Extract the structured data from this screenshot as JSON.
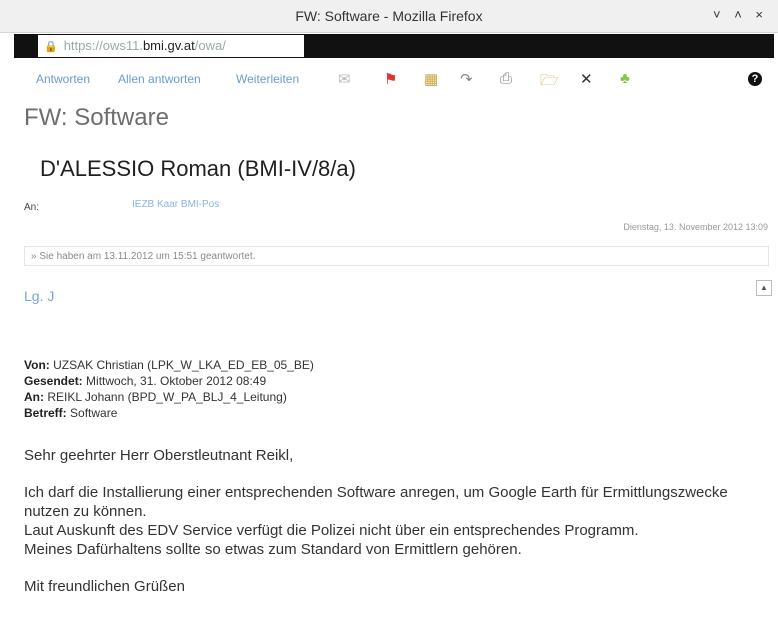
{
  "window": {
    "title": "FW: Software - Mozilla Firefox",
    "controls": "˅ ˄ ×"
  },
  "url": {
    "prefix": "https://ows11.",
    "domain": "bmi.gv.at",
    "suffix": "/owa/"
  },
  "toolbar": {
    "reply": "Antworten",
    "reply_all": "Allen antworten",
    "forward": "Weiterleiten",
    "help": "?"
  },
  "message": {
    "subject": "FW: Software",
    "sender": "D'ALESSIO Roman (BMI-IV/8/a)",
    "to_label": "An:",
    "to_value": "IEZB Kaar BMI-Pos",
    "date": "Dienstag, 13. November 2012 13:09",
    "info": "Sie haben am 13.11.2012 um 15:51 geantwortet.",
    "greeting": "Lg. J",
    "fwd": {
      "from_label": "Von:",
      "from_value": "UZSAK Christian (LPK_W_LKA_ED_EB_05_BE)",
      "sent_label": "Gesendet:",
      "sent_value": "Mittwoch, 31. Oktober 2012 08:49",
      "to_label": "An:",
      "to_value": "REIKL Johann (BPD_W_PA_BLJ_4_Leitung)",
      "subject_label": "Betreff:",
      "subject_value": "Software"
    },
    "body": {
      "salutation": "Sehr geehrter Herr Oberstleutnant Reikl,",
      "line1": "Ich darf die Installierung einer entsprechenden Software anregen, um Google Earth für Ermittlungszwecke nutzen zu können.",
      "line2": "Laut Auskunft des EDV Service verfügt die Polizei nicht über ein entsprechendes Programm.",
      "line3": "Meines Dafürhaltens sollte so etwas zum Standard von Ermittlern gehören.",
      "closing": "Mit freundlichen Grüßen"
    }
  },
  "colors": {
    "link": "#6a9bd0",
    "url_bar_redaction": "#111111"
  }
}
